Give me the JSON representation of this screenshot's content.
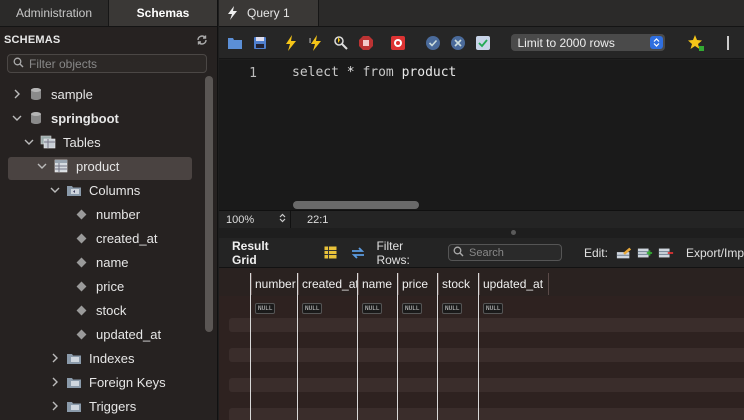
{
  "left_tabs": {
    "administration": "Administration",
    "schemas": "Schemas"
  },
  "schemas_header": "SCHEMAS",
  "filter": {
    "placeholder": "Filter objects"
  },
  "tree": {
    "sample": "sample",
    "springboot": "springboot",
    "tables": "Tables",
    "product": "product",
    "columns": "Columns",
    "column_items": [
      "number",
      "created_at",
      "name",
      "price",
      "stock",
      "updated_at"
    ],
    "indexes": "Indexes",
    "foreign_keys": "Foreign Keys",
    "triggers": "Triggers"
  },
  "query_tab": "Query 1",
  "toolbar": {
    "limit_select": "Limit to 2000 rows"
  },
  "editor": {
    "line_number": "1",
    "code_kw1": "select",
    "code_star": "*",
    "code_kw2": "from",
    "code_table": "product"
  },
  "status": {
    "zoom": "100%",
    "cursor_position": "22:1"
  },
  "result_grid": {
    "title": "Result Grid",
    "filter_rows_label": "Filter Rows:",
    "search_placeholder": "Search",
    "edit_label": "Edit:",
    "export_label": "Export/Imp",
    "columns": [
      "number",
      "created_at",
      "name",
      "price",
      "stock",
      "updated_at"
    ],
    "null_value": "NULL"
  },
  "colors": {
    "accent_blue": "#2f6fe0",
    "selected_row": "#4a4341",
    "grid_bg": "#2a2220"
  }
}
